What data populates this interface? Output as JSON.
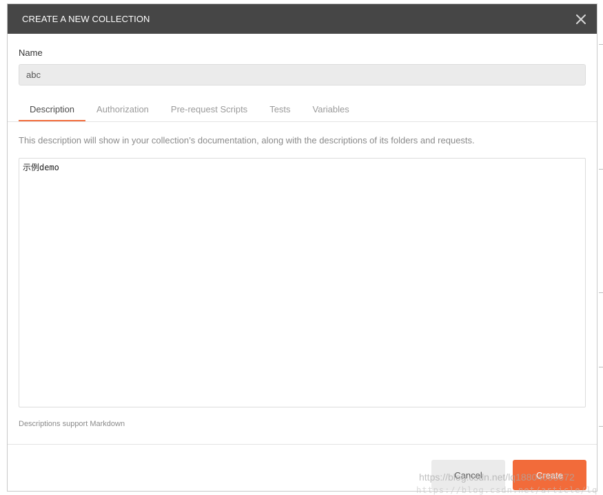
{
  "dialog": {
    "title": "CREATE A NEW COLLECTION",
    "close_icon": "close-icon"
  },
  "name": {
    "label": "Name",
    "value": "abc"
  },
  "tabs": [
    {
      "label": "Description",
      "active": true
    },
    {
      "label": "Authorization",
      "active": false
    },
    {
      "label": "Pre-request Scripts",
      "active": false
    },
    {
      "label": "Tests",
      "active": false
    },
    {
      "label": "Variables",
      "active": false
    }
  ],
  "description": {
    "help_text": "This description will show in your collection’s documentation, along with the descriptions of its folders and requests.",
    "value": "示例demo",
    "markdown_note": "Descriptions support Markdown"
  },
  "footer": {
    "cancel_label": "Cancel",
    "create_label": "Create"
  },
  "watermark": {
    "line1": "https://blog.csdn.net/lq18804095672",
    "line2": "https://blog.csdn.net/article/lq"
  },
  "colors": {
    "header_bg": "#464646",
    "accent": "#f26b3a",
    "input_bg": "#ebebeb"
  }
}
